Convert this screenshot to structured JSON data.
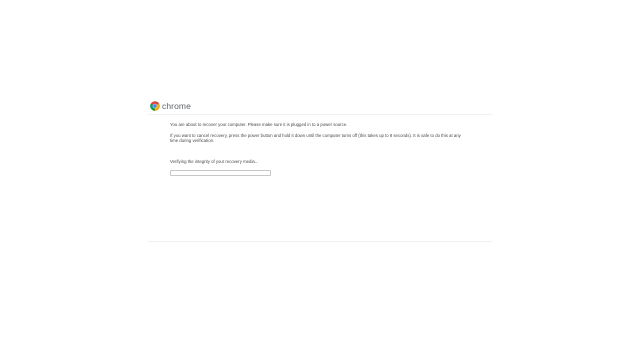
{
  "brand": {
    "name": "chrome",
    "icon": "chrome-logo-icon"
  },
  "recovery": {
    "intro": "You are about to recover your computer. Please make sure it is plugged in to a power source.",
    "cancel_instructions": "If you want to cancel recovery, press the power button and hold it down until the computer turns off (this takes up to 8 seconds). It is safe to do this at any time during verification.",
    "status": "Verifying the integrity of your recovery media..."
  },
  "progress": {
    "fraction": 0
  },
  "colors": {
    "background": "#ffffff",
    "text": "#4a4a4a",
    "brand_text": "#5f6368",
    "progress_border": "#c8c8c8"
  }
}
